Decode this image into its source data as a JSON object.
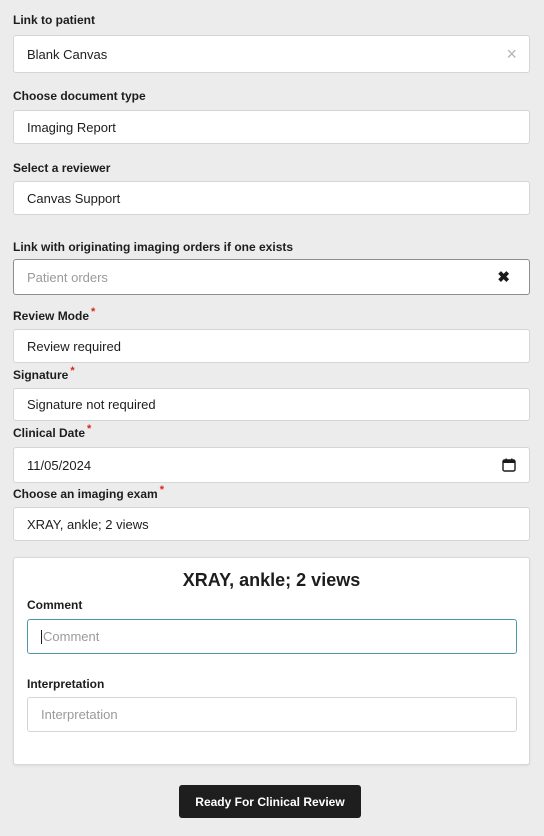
{
  "patient": {
    "label": "Link to patient",
    "value": "Blank Canvas",
    "clear_icon": "×"
  },
  "document_type": {
    "label": "Choose document type",
    "value": "Imaging Report"
  },
  "reviewer": {
    "label": "Select a reviewer",
    "value": "Canvas Support"
  },
  "orders": {
    "label": "Link with originating imaging orders if one exists",
    "placeholder": "Patient orders",
    "clear_icon": "✖"
  },
  "review_mode": {
    "label": "Review Mode",
    "required": "*",
    "value": "Review required"
  },
  "signature": {
    "label": "Signature",
    "required": "*",
    "value": "Signature not required"
  },
  "clinical_date": {
    "label": "Clinical Date",
    "required": "*",
    "value": "11/05/2024"
  },
  "imaging_exam": {
    "label": "Choose an imaging exam",
    "required": "*",
    "value": "XRAY, ankle; 2 views"
  },
  "exam_card": {
    "title": "XRAY, ankle; 2 views",
    "comment_label": "Comment",
    "comment_placeholder": "Comment",
    "interpretation_label": "Interpretation",
    "interpretation_placeholder": "Interpretation"
  },
  "submit_label": "Ready For Clinical Review",
  "colors": {
    "background": "#ececec",
    "required": "#d9251d",
    "focus_border": "#4d9aa6",
    "button": "#1e1e1e"
  }
}
